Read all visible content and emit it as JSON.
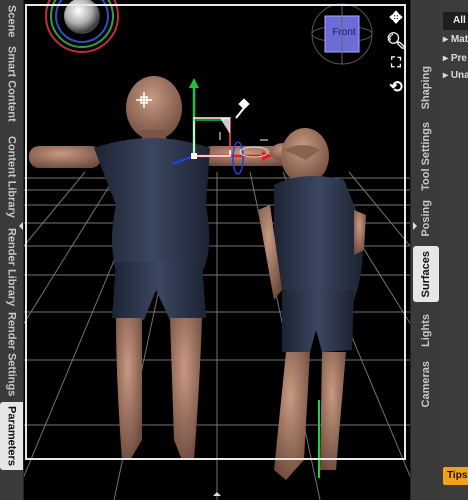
{
  "left_tabs": [
    "Scene",
    "Smart Content",
    "Content Library",
    "Render Library",
    "Render Settings",
    "Parameters"
  ],
  "left_active": "Parameters",
  "right_tabs": [
    "Shaping",
    "Tool Settings",
    "Posing",
    "Surfaces",
    "Lights",
    "Cameras"
  ],
  "right_active": "Surfaces",
  "panel": {
    "all_button": "All",
    "items": [
      "Mat",
      "Pre",
      "Una"
    ]
  },
  "tips_button": "Tips",
  "viewcube": {
    "label": "Front"
  },
  "icons": {
    "move": "move-icon",
    "zoom": "zoom-icon",
    "frame": "frame-icon",
    "reset": "reset-icon"
  },
  "colors": {
    "viewport_bg": "#000000",
    "tips": "#f3a21b",
    "gizmo_x": "#e02020",
    "gizmo_y": "#20c040",
    "gizmo_z": "#2040e0"
  }
}
